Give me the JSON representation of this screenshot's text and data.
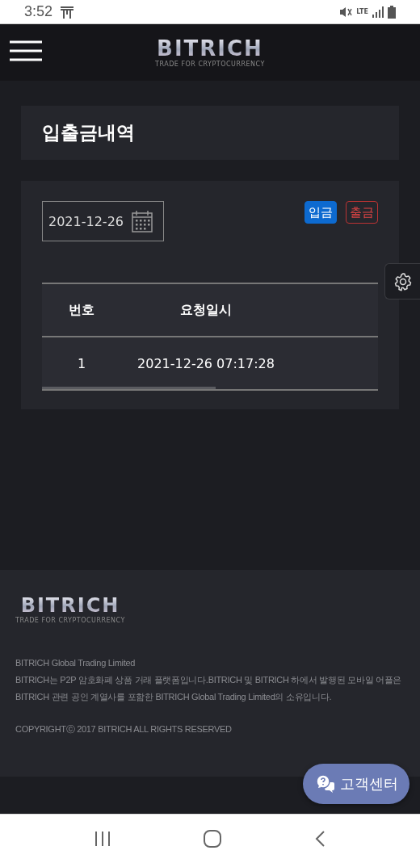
{
  "status_bar": {
    "time": "3:52",
    "network": "LTE"
  },
  "header": {
    "logo": "BITRICH",
    "tagline": "TRADE FOR CRYPTOCURRENCY"
  },
  "page_title": "입출금내역",
  "filter": {
    "date": "2021-12-26",
    "buttons": [
      {
        "label": "입금",
        "kind": "deposit"
      },
      {
        "label": "출금",
        "kind": "withdraw"
      }
    ]
  },
  "table": {
    "columns": [
      "번호",
      "요청일시"
    ],
    "rows": [
      [
        "1",
        "2021-12-26 07:17:28"
      ]
    ]
  },
  "footer": {
    "logo": "BITRICH",
    "tagline": "TRADE FOR CRYPTOCURRENCY",
    "company": "BITRICH Global Trading Limited",
    "description": "BITRICH는 P2P 암호화폐 상품 거래 플랫폼입니다.BITRICH 및 BITRICH 하에서 발행된 모바일 어플은 BITRICH 관련 공인 계열사를 포함한 BITRICH Global Trading Limited의 소유입니다.",
    "copyright": "COPYRIGHTⓒ 2017 BITRICH ALL RIGHTS RESERVED"
  },
  "support_button": "고객센터"
}
